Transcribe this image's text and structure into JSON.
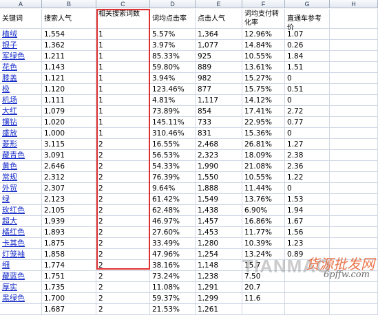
{
  "columns": [
    "A",
    "B",
    "C",
    "D",
    "E",
    "F",
    "G",
    "H"
  ],
  "headers": [
    "关键词",
    "搜索人气",
    "相关搜索词数",
    "词均点击率",
    "点击人气",
    "词均支付转化率",
    "直通车参考价",
    ""
  ],
  "rows": [
    [
      "植绒",
      "1,554",
      "1",
      "5.57%",
      "1,364",
      "12.96%",
      "1.07"
    ],
    [
      "银子",
      "1,362",
      "1",
      "3.97%",
      "1,077",
      "14.84%",
      "0.26"
    ],
    [
      "军绿色",
      "1,211",
      "1",
      "85.33%",
      "925",
      "10.55%",
      "1.84"
    ],
    [
      "花色",
      "1,143",
      "1",
      "59.80%",
      "889",
      "13.61%",
      "1.51"
    ],
    [
      "膝盖",
      "1,121",
      "1",
      "3.94%",
      "982",
      "15.27%",
      "0"
    ],
    [
      "极",
      "1,120",
      "1",
      "123.46%",
      "877",
      "15.75%",
      "0.51"
    ],
    [
      "机场",
      "1,111",
      "1",
      "4.81%",
      "1,117",
      "14.12%",
      "0"
    ],
    [
      "大红",
      "1,079",
      "1",
      "73.89%",
      "854",
      "17.41%",
      "2.72"
    ],
    [
      "镶钻",
      "1,020",
      "1",
      "145.11%",
      "733",
      "22.95%",
      "0.77"
    ],
    [
      "盛放",
      "1,000",
      "1",
      "310.46%",
      "831",
      "15.36%",
      "0"
    ],
    [
      "菱形",
      "3,115",
      "2",
      "16.55%",
      "2,468",
      "26.81%",
      "1.27"
    ],
    [
      "藏青色",
      "3,091",
      "2",
      "56.53%",
      "2,323",
      "18.09%",
      "2.38"
    ],
    [
      "黄色",
      "2,646",
      "2",
      "54.33%",
      "1,990",
      "21.08%",
      "2.36"
    ],
    [
      "常规",
      "2,312",
      "2",
      "76.39%",
      "1,550",
      "10.55%",
      "1.22"
    ],
    [
      "外贸",
      "2,307",
      "2",
      "9.64%",
      "1,888",
      "11.44%",
      "0"
    ],
    [
      "绿",
      "2,123",
      "2",
      "61.42%",
      "1,549",
      "13.76%",
      "1.53"
    ],
    [
      "玫红色",
      "2,105",
      "2",
      "62.48%",
      "1,438",
      "6.90%",
      "1.94"
    ],
    [
      "超大",
      "1,939",
      "2",
      "46.97%",
      "1,457",
      "16.86%",
      "1.67"
    ],
    [
      "橘红色",
      "1,893",
      "2",
      "27.60%",
      "1,453",
      "11.77%",
      "1.56"
    ],
    [
      "卡其色",
      "1,875",
      "2",
      "33.49%",
      "1,280",
      "10.39%",
      "1.23"
    ],
    [
      "灯笼袖",
      "1,858",
      "2",
      "47.96%",
      "1,254",
      "13.24%",
      "0.89"
    ],
    [
      "细",
      "1,774",
      "2",
      "38.16%",
      "1,148",
      "15.7",
      ""
    ],
    [
      "藏蓝色",
      "1,751",
      "2",
      "73.24%",
      "1,238",
      "7.50",
      ""
    ],
    [
      "厚实",
      "1,735",
      "2",
      "11.08%",
      "1,291",
      "20.7",
      ""
    ],
    [
      "黑绿色",
      "1,700",
      "2",
      "59.37%",
      "1,299",
      "11.6",
      ""
    ],
    [
      "",
      "1,687",
      "2",
      "21.53%",
      "1,261",
      "",
      ""
    ]
  ],
  "watermark": {
    "text": "TIANMAO",
    "chinese": "货源批发网",
    "url": "6pffw.com"
  },
  "colors": {
    "highlight_border": "#e03030",
    "link_text": "#1a2fc9",
    "grid_line": "#d0d7e5"
  }
}
